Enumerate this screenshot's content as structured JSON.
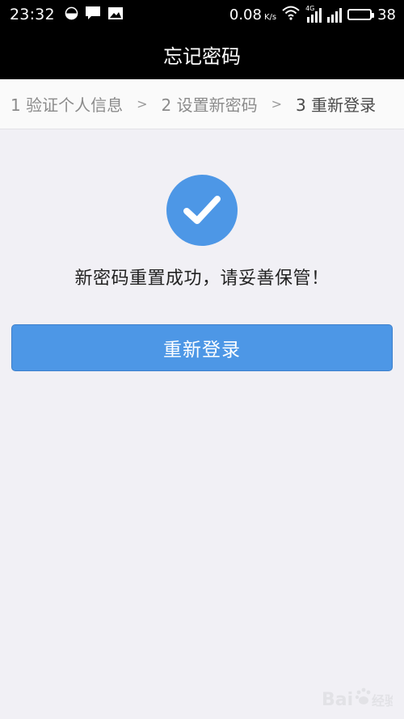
{
  "status_bar": {
    "time": "23:32",
    "speed_value": "0.08",
    "speed_unit": "K/s",
    "network_tag": "4G",
    "battery_level": "38",
    "battery_fraction": 0.38
  },
  "header": {
    "title": "忘记密码"
  },
  "steps": [
    {
      "label": "1 验证个人信息",
      "active": false
    },
    {
      "label": "2 设置新密码",
      "active": false
    },
    {
      "label": "3 重新登录",
      "active": true
    }
  ],
  "step_separator": ">",
  "success": {
    "icon": "check-circle-icon",
    "message": "新密码重置成功，请妥善保管！"
  },
  "relogin_button": {
    "label": "重新登录"
  },
  "colors": {
    "accent": "#4d97e6",
    "background": "#f1f0f5",
    "title_bar": "#000000"
  }
}
